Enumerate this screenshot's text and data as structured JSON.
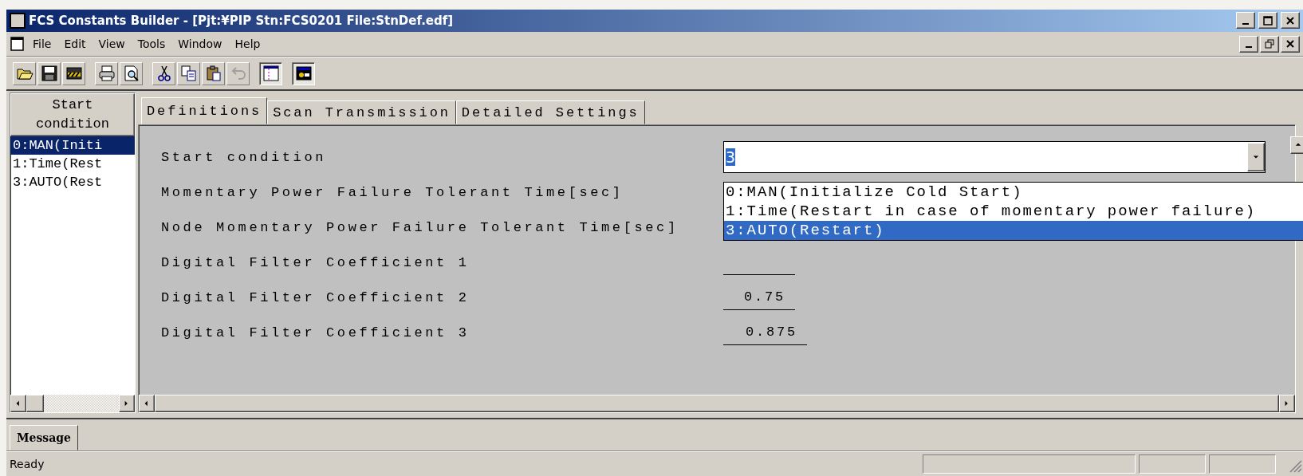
{
  "window": {
    "title": "FCS Constants Builder - [Pjt:¥PIP Stn:FCS0201 File:StnDef.edf]"
  },
  "menu": [
    "File",
    "Edit",
    "View",
    "Tools",
    "Window",
    "Help"
  ],
  "toolbar": [
    [
      {
        "kind": "open",
        "disabled": false,
        "pressed": false
      },
      {
        "kind": "save",
        "disabled": false,
        "pressed": false
      },
      {
        "kind": "save-all",
        "disabled": false,
        "pressed": false
      }
    ],
    [
      {
        "kind": "print",
        "disabled": false,
        "pressed": false
      },
      {
        "kind": "preview",
        "disabled": false,
        "pressed": false
      }
    ],
    [
      {
        "kind": "cut",
        "disabled": false,
        "pressed": false
      },
      {
        "kind": "copy",
        "disabled": false,
        "pressed": false
      },
      {
        "kind": "paste",
        "disabled": false,
        "pressed": false
      },
      {
        "kind": "undo",
        "disabled": true,
        "pressed": false
      }
    ],
    [
      {
        "kind": "pane",
        "disabled": false,
        "pressed": true
      }
    ],
    [
      {
        "kind": "window",
        "disabled": false,
        "pressed": true
      }
    ]
  ],
  "side_list": {
    "header": "Start condition",
    "items": [
      {
        "label": "0:MAN(Initi",
        "selected": true
      },
      {
        "label": "1:Time(Rest",
        "selected": false
      },
      {
        "label": "3:AUTO(Rest",
        "selected": false
      }
    ]
  },
  "tabs": [
    {
      "label": "Definitions",
      "selected": true
    },
    {
      "label": "Scan Transmission",
      "selected": false
    },
    {
      "label": "Detailed Settings",
      "selected": false
    }
  ],
  "fields": [
    {
      "label": "Start condition",
      "kind": "combo",
      "value": "3"
    },
    {
      "label": "Momentary Power Failure Tolerant Time[sec]",
      "kind": "covered"
    },
    {
      "label": "Node Momentary Power Failure Tolerant Time[sec]",
      "kind": "covered"
    },
    {
      "label": "Digital Filter Coefficient 1",
      "kind": "line"
    },
    {
      "label": "Digital Filter Coefficient 2",
      "kind": "number",
      "value": "0.75"
    },
    {
      "label": "Digital Filter Coefficient 3",
      "kind": "number",
      "value": "0.875"
    }
  ],
  "dropdown": {
    "items": [
      {
        "label": "0:MAN(Initialize Cold Start)",
        "selected": false
      },
      {
        "label": "1:Time(Restart in case of momentary power failure)",
        "selected": false
      },
      {
        "label": "3:AUTO(Restart)",
        "selected": true
      }
    ]
  },
  "message_tab": "Message",
  "status_bar": {
    "text": "Ready"
  }
}
